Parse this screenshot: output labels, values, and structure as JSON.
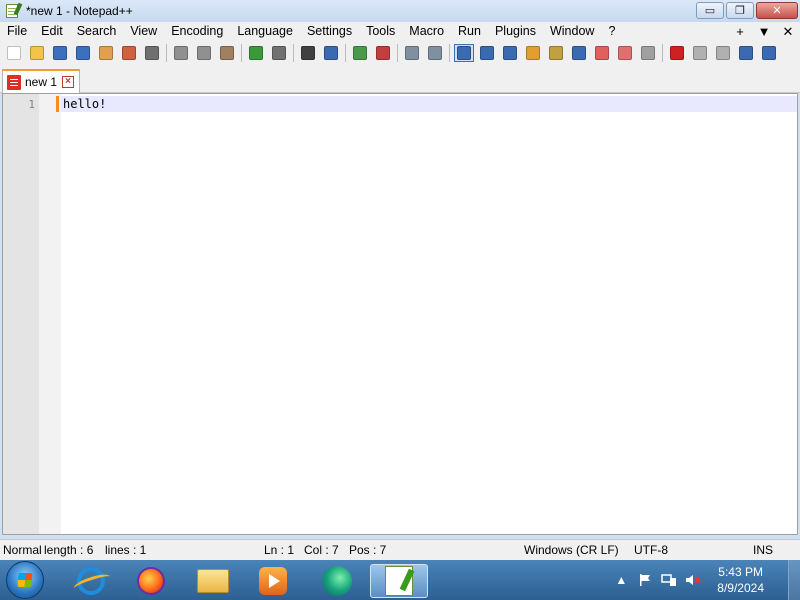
{
  "window": {
    "title": "*new 1 - Notepad++",
    "minimize_label": "▭",
    "restore_label": "❐",
    "close_label": "✕"
  },
  "menu": {
    "items": [
      "File",
      "Edit",
      "Search",
      "View",
      "Encoding",
      "Language",
      "Settings",
      "Tools",
      "Macro",
      "Run",
      "Plugins",
      "Window",
      "?"
    ],
    "right": [
      "+",
      "▼",
      "✕"
    ]
  },
  "toolbar": {
    "buttons": [
      {
        "name": "new-file",
        "color": "#ffffff"
      },
      {
        "name": "open-file",
        "color": "#f3c44a"
      },
      {
        "name": "save",
        "color": "#3c6fbe"
      },
      {
        "name": "save-all",
        "color": "#3c6fbe"
      },
      {
        "name": "close",
        "color": "#e0a050"
      },
      {
        "name": "close-all",
        "color": "#d06040"
      },
      {
        "name": "print",
        "color": "#707070"
      },
      {
        "name": "cut",
        "color": "#909090"
      },
      {
        "name": "copy",
        "color": "#909090"
      },
      {
        "name": "paste",
        "color": "#a08060"
      },
      {
        "name": "undo",
        "color": "#3a9a3a"
      },
      {
        "name": "redo",
        "color": "#707070"
      },
      {
        "name": "find",
        "color": "#404040"
      },
      {
        "name": "replace",
        "color": "#3a6ab0"
      },
      {
        "name": "zoom-in",
        "color": "#4a9a4a"
      },
      {
        "name": "zoom-out",
        "color": "#c04040"
      },
      {
        "name": "sync-vertical",
        "color": "#8090a0"
      },
      {
        "name": "sync-horizontal",
        "color": "#8090a0"
      },
      {
        "name": "word-wrap",
        "color": "#3a6ab0"
      },
      {
        "name": "show-all-chars",
        "color": "#3a6ab0"
      },
      {
        "name": "indent-guide",
        "color": "#3a6ab0"
      },
      {
        "name": "udl",
        "color": "#e0a030"
      },
      {
        "name": "doc-map",
        "color": "#c0a040"
      },
      {
        "name": "function-list",
        "color": "#3a6ab0"
      },
      {
        "name": "folder-workspace",
        "color": "#e06060"
      },
      {
        "name": "doc-list",
        "color": "#e07070"
      },
      {
        "name": "monitoring",
        "color": "#a0a0a0"
      },
      {
        "name": "record-macro",
        "color": "#d02020"
      },
      {
        "name": "stop-macro",
        "color": "#b0b0b0"
      },
      {
        "name": "play-macro",
        "color": "#b0b0b0"
      },
      {
        "name": "run-macro-multiple",
        "color": "#3a6ab0"
      },
      {
        "name": "save-macro",
        "color": "#3a6ab0"
      }
    ]
  },
  "tab": {
    "label": "new 1",
    "close_label": "×"
  },
  "editor": {
    "line_number": "1",
    "line_text": "hello!"
  },
  "status": {
    "doc_type": "Normal text file",
    "length": "length : 6",
    "lines": "lines : 1",
    "ln": "Ln : 1",
    "col": "Col : 7",
    "pos": "Pos : 7",
    "eol": "Windows (CR LF)",
    "encoding": "UTF-8",
    "mode": "INS"
  },
  "taskbar": {
    "time": "5:43 PM",
    "date": "8/9/2024",
    "tray_arrow": "▲"
  }
}
